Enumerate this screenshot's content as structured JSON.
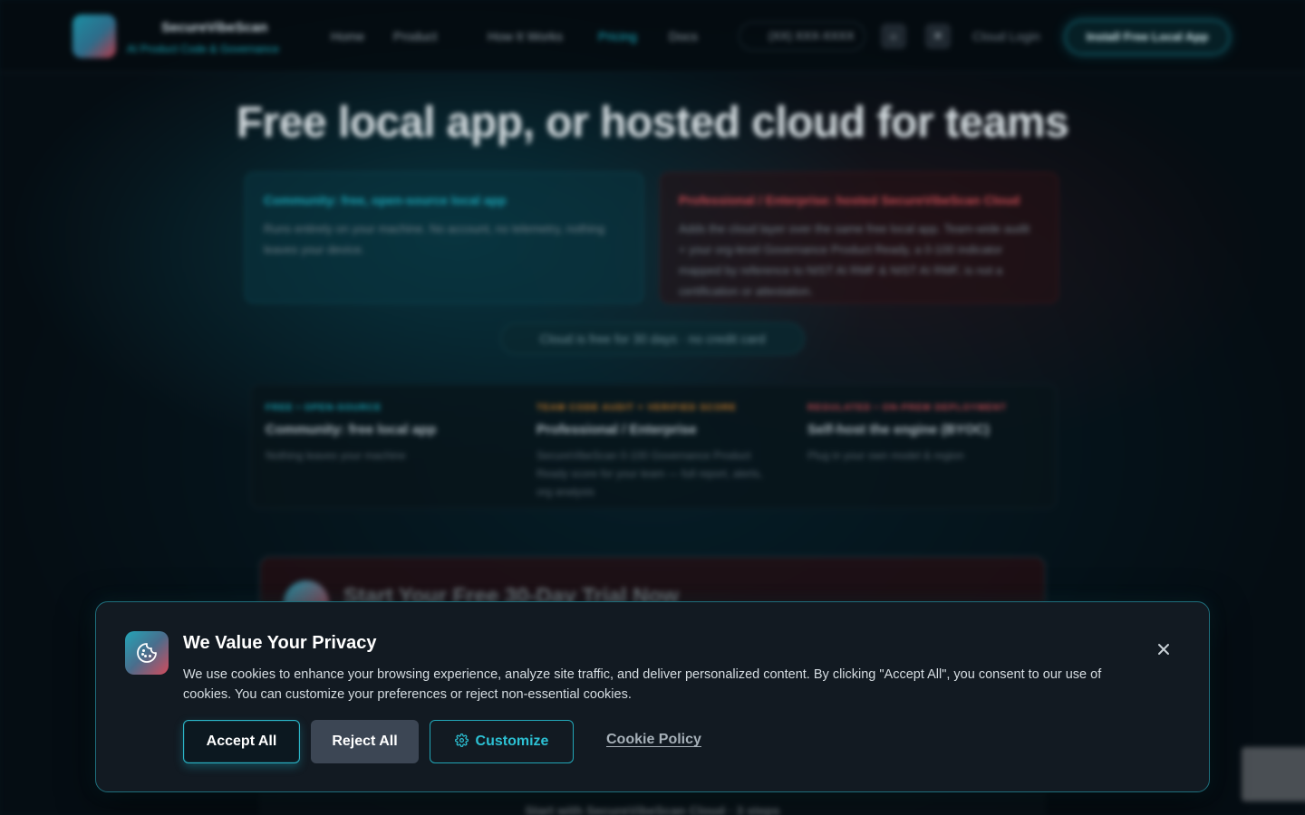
{
  "background": {
    "nav": {
      "brand_name": "SecureVibeScan",
      "brand_tagline": "AI Product Code & Governance",
      "links": [
        "Home",
        "Product",
        "How It Works",
        "Pricing",
        "Docs"
      ],
      "active_link": "Pricing",
      "phone": "(XX) XXX-XXXX",
      "login": "Cloud Login",
      "cta": "Install Free Local App"
    },
    "hero_title": "Free local app, or hosted cloud for teams",
    "card_community": {
      "title": "Community: free, open-source local app",
      "text": "Runs entirely on your machine. No account, no telemetry, nothing leaves your device."
    },
    "card_professional": {
      "title": "Professional / Enterprise: hosted SecureVibeScan Cloud",
      "text": "Adds the cloud layer over the same free local app. Team-wide audit + your org-level Governance Product Ready, a 0-100 indicator mapped by reference to NIST AI RMF & NIST AI RMF, is not a certification or attestation."
    },
    "trial_pill": "Cloud is free for 30 days · no credit card",
    "tiers": [
      {
        "kicker": "FREE • OPEN-SOURCE",
        "name": "Community: free local app",
        "desc": "Nothing leaves your machine",
        "color": "#1aa7b8"
      },
      {
        "kicker": "TEAM CODE AUDIT + VERIFIED SCORE",
        "name": "Professional / Enterprise",
        "desc": "SecureVibeScan 0-100 Governance Product Ready score for your team — full report, alerts, org analysis",
        "color": "#c47a2a"
      },
      {
        "kicker": "REGULATED • ON-PREM DEPLOYMENT",
        "name": "Self-host the engine (BYOC)",
        "desc": "Plug in your own model & region",
        "color": "#c44a52"
      }
    ],
    "banner_title": "Start Your Free 30-Day Trial Now",
    "bottom_text": "Start with SecureVibeScan Cloud · 3 steps"
  },
  "cookie_banner": {
    "title": "We Value Your Privacy",
    "text": "We use cookies to enhance your browsing experience, analyze site traffic, and deliver personalized content. By clicking \"Accept All\", you consent to our use of cookies. You can customize your preferences or reject non-essential cookies.",
    "accept_label": "Accept All",
    "reject_label": "Reject All",
    "customize_label": "Customize",
    "policy_label": "Cookie Policy",
    "icons": {
      "logo": "cookie-icon",
      "close": "close-icon",
      "customize": "gear-icon"
    },
    "colors": {
      "accent": "#2cc0d3",
      "panel": "#121a22",
      "reject_bg": "#3c4654"
    }
  }
}
